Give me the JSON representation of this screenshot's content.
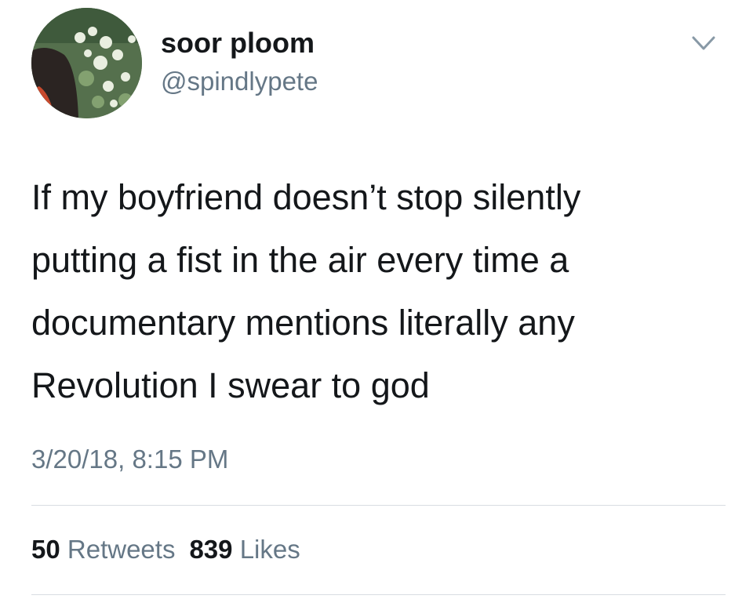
{
  "tweet": {
    "display_name": "soor ploom",
    "handle": "@spindlypete",
    "text_lines": [
      "If my boyfriend doesn’t stop silently",
      "putting a fist in the air every time a",
      "documentary mentions literally any",
      "Revolution I swear to god"
    ],
    "timestamp": "3/20/18, 8:15 PM",
    "stats": {
      "retweets_count": "50",
      "retweets_label": "Retweets",
      "likes_count": "839",
      "likes_label": "Likes"
    }
  },
  "icons": {
    "menu": "chevron-down-icon",
    "avatar": "profile-photo"
  },
  "colors": {
    "text_primary": "#14171a",
    "text_secondary": "#657786",
    "divider": "#d8dde2",
    "background": "#ffffff"
  }
}
